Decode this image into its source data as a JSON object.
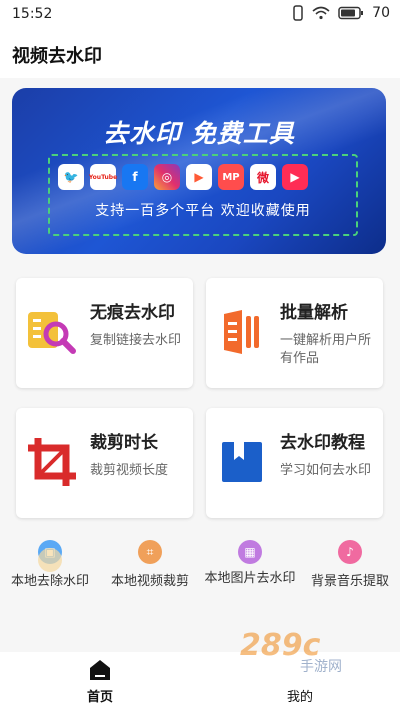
{
  "status_bar": {
    "time": "15:52",
    "battery": "70",
    "icons": [
      "vibrate-icon",
      "wifi-icon",
      "battery-icon"
    ]
  },
  "app_bar": {
    "title": "视频去水印"
  },
  "banner": {
    "title": "去水印 免费工具",
    "subtitle": "支持一百多个平台  欢迎收藏使用",
    "logos": [
      {
        "name": "twitter-logo",
        "glyph": "🐦",
        "color": "#1da1f2"
      },
      {
        "name": "youtube-logo",
        "glyph": "YouTube",
        "color": "#ffffff"
      },
      {
        "name": "facebook-logo",
        "glyph": "f",
        "color": "#1877f2"
      },
      {
        "name": "instagram-logo",
        "glyph": "◎",
        "color": "#e1306c"
      },
      {
        "name": "video-play-logo",
        "glyph": "▶",
        "color": "#ff5a36"
      },
      {
        "name": "mp-logo",
        "glyph": "MP",
        "color": "#ff4d4d"
      },
      {
        "name": "weibo-logo",
        "glyph": "微",
        "color": "#e6162d"
      },
      {
        "name": "play-circle-logo",
        "glyph": "▶",
        "color": "#ff2d55"
      }
    ]
  },
  "cards": [
    {
      "title": "无痕去水印",
      "desc": "复制链接去水印",
      "icon": "magnifier-icon",
      "color": "#f3c13a"
    },
    {
      "title": "批量解析",
      "desc": "一键解析用户所有作品",
      "icon": "parse-icon",
      "color": "#f26a2c"
    },
    {
      "title": "裁剪时长",
      "desc": "裁剪视频长度",
      "icon": "crop-icon",
      "color": "#d92b2b"
    },
    {
      "title": "去水印教程",
      "desc": "学习如何去水印",
      "icon": "tutorial-icon",
      "color": "#1b5fc9"
    }
  ],
  "tools": [
    {
      "label": "本地去除水印",
      "icon": "local-remove-icon",
      "color": "#5aa9f5"
    },
    {
      "label": "本地视频裁剪",
      "icon": "video-crop-icon",
      "color": "#f0a05a"
    },
    {
      "label": "本地图片去水印",
      "icon": "image-remove-icon",
      "color": "#c07be0"
    },
    {
      "label": "背景音乐提取",
      "icon": "music-icon",
      "color": "#f06aa0"
    }
  ],
  "bottom_nav": {
    "home_label": "首页",
    "mine_label": "我的"
  },
  "watermark": {
    "brand": "289c",
    "tagline": "手游网"
  }
}
